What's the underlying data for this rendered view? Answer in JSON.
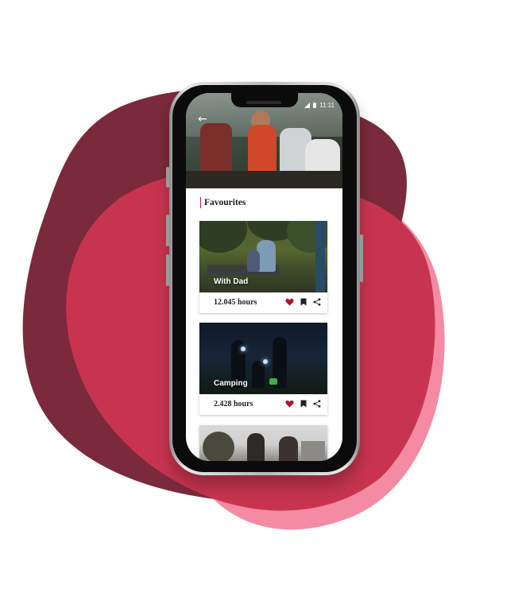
{
  "status_bar": {
    "time": "11:11"
  },
  "header": {
    "back_icon": "arrow-left-icon"
  },
  "section": {
    "title": "Favourites"
  },
  "cards": [
    {
      "label": "With Dad",
      "hours": "12.045 hours",
      "liked": true
    },
    {
      "label": "Camping",
      "hours": "2.428 hours",
      "liked": true
    }
  ],
  "colors": {
    "blob_dark": "#7a2a3b",
    "blob_mid": "#c8344f",
    "blob_light": "#f08aa0",
    "heart": "#b3122c",
    "accent_line": "#c2185b"
  }
}
